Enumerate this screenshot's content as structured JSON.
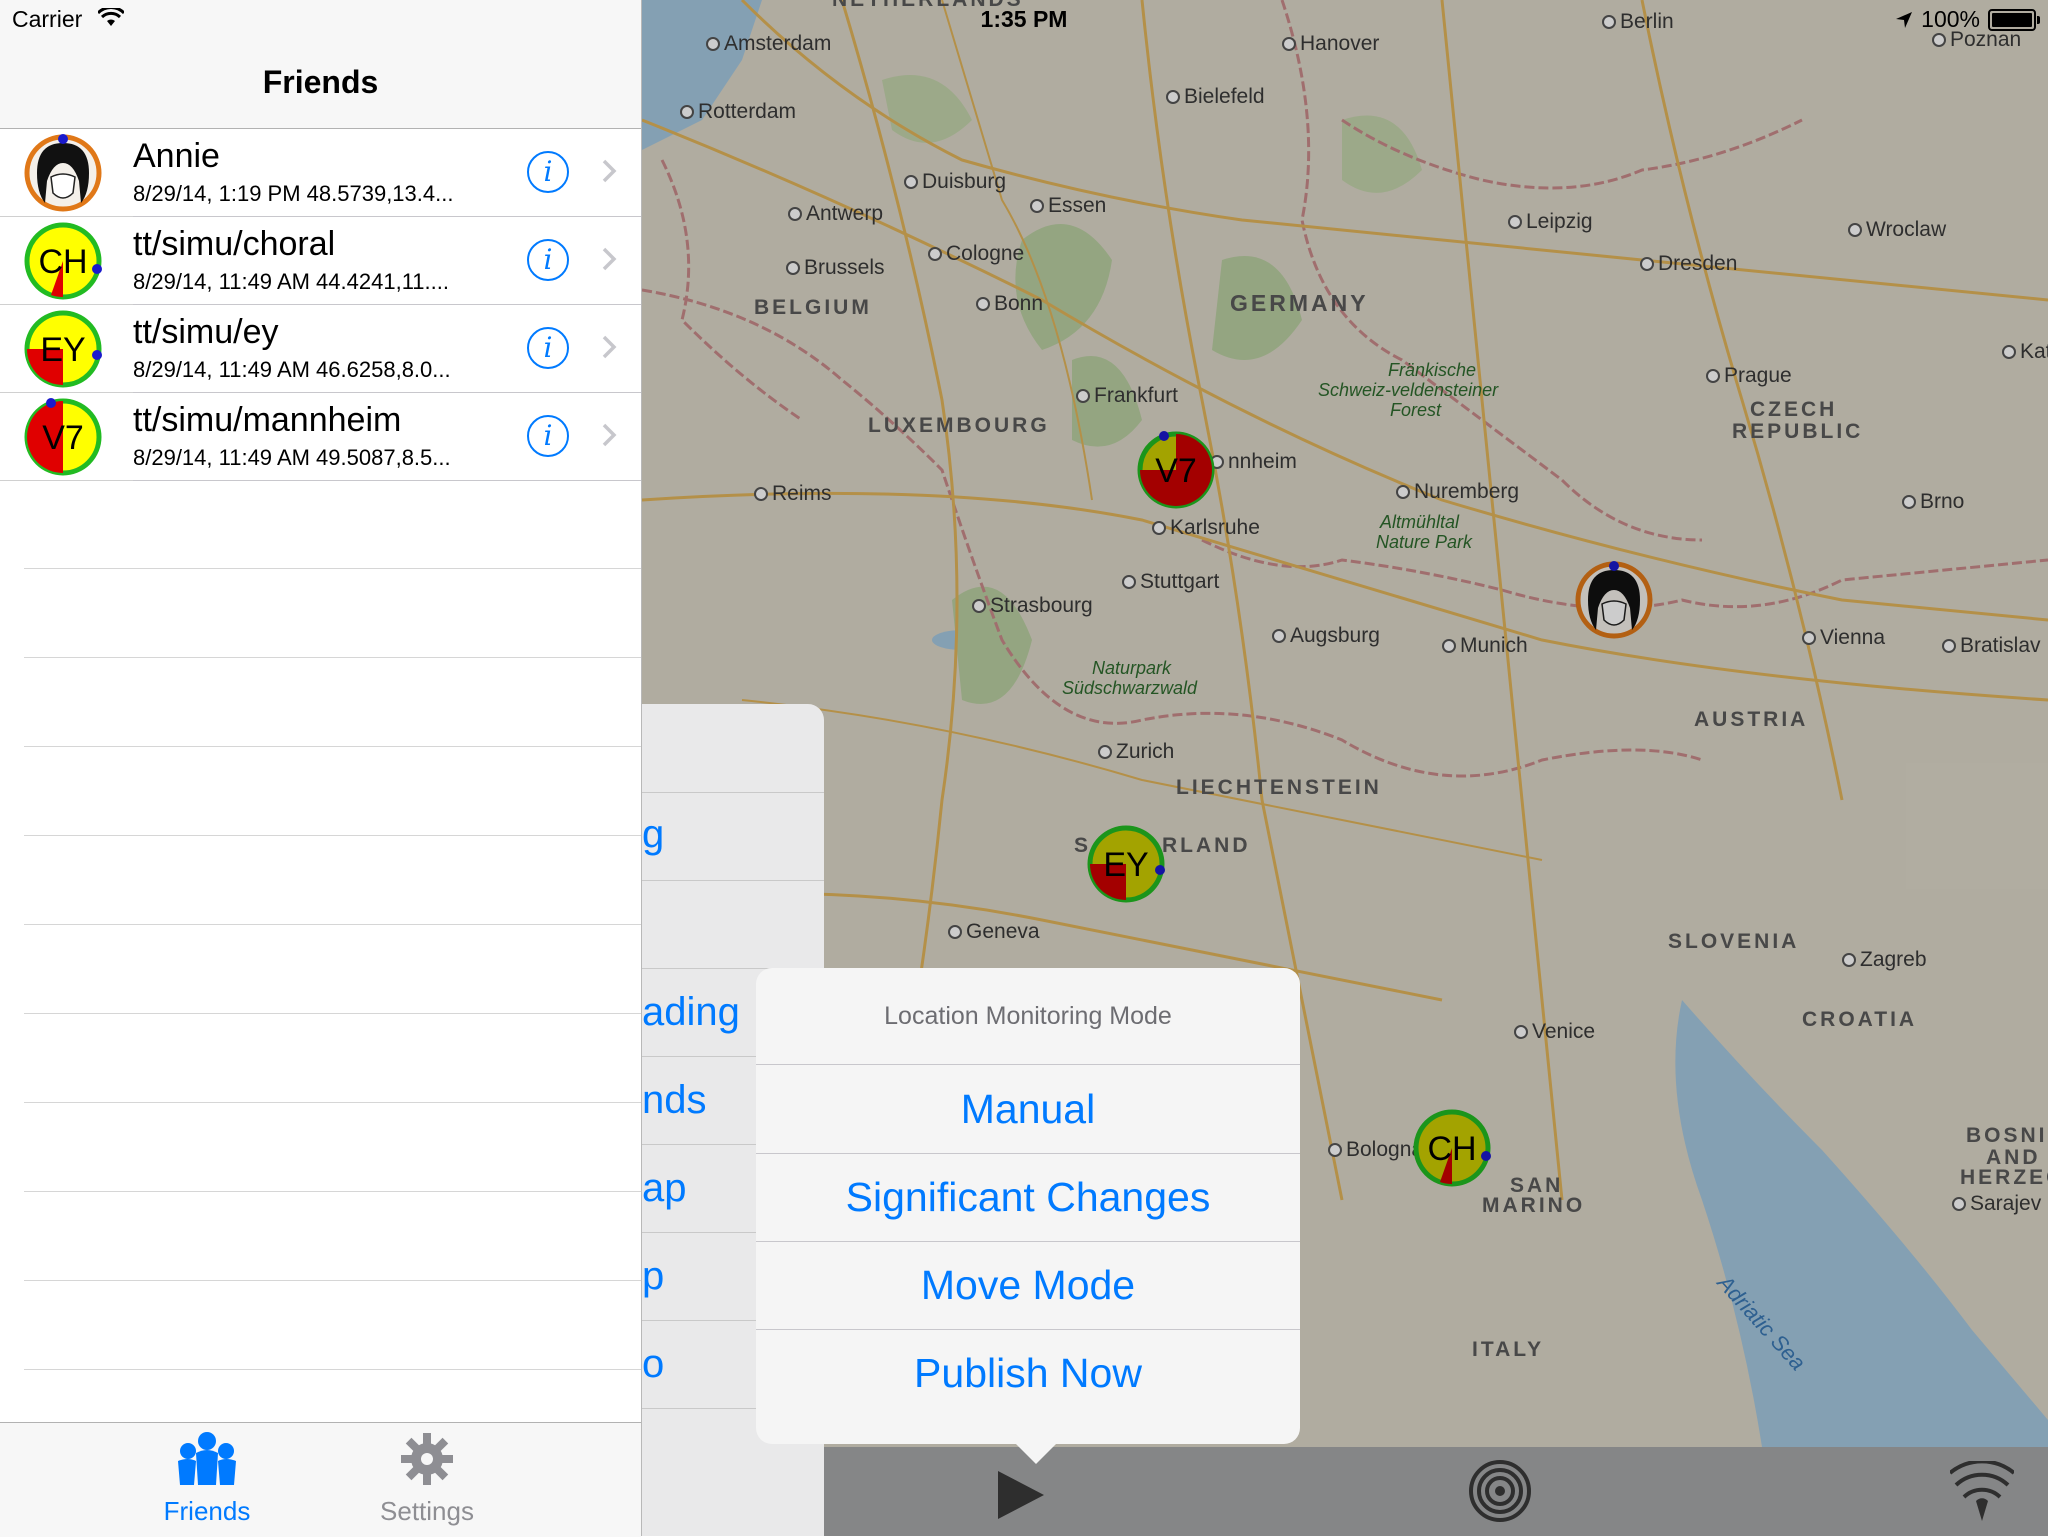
{
  "status_bar": {
    "carrier": "Carrier",
    "time": "1:35 PM",
    "battery": "100%"
  },
  "left_pane": {
    "title": "Friends",
    "friends": [
      {
        "name": "Annie",
        "detail": "8/29/14, 1:19 PM 48.5739,13.4...",
        "avatar": "portrait"
      },
      {
        "name": "tt/simu/choral",
        "detail": "8/29/14, 11:49 AM 44.4241,11....",
        "avatar": "CH"
      },
      {
        "name": "tt/simu/ey",
        "detail": "8/29/14, 11:49 AM 46.6258,8.0...",
        "avatar": "EY"
      },
      {
        "name": "tt/simu/mannheim",
        "detail": "8/29/14, 11:49 AM 49.5087,8.5...",
        "avatar": "V7"
      }
    ],
    "tabs": [
      {
        "label": "Friends",
        "icon": "friends-icon",
        "selected": true
      },
      {
        "label": "Settings",
        "icon": "gear-icon",
        "selected": false
      }
    ]
  },
  "map": {
    "cities": [
      "Amsterdam",
      "Hanover",
      "Berlin",
      "Poznan",
      "Rotterdam",
      "Bielefeld",
      "Duisburg",
      "Essen",
      "Antwerp",
      "Leipzig",
      "Wroclaw",
      "Cologne",
      "Brussels",
      "Dresden",
      "Bonn",
      "Prague",
      "Frankfurt",
      "nnheim",
      "Reims",
      "Nuremberg",
      "Karlsruhe",
      "Brno",
      "Stuttgart",
      "Strasbourg",
      "Augsburg",
      "Munich",
      "Vienna",
      "Bratislav",
      "Zurich",
      "Geneva",
      "Zagreb",
      "Venice",
      "Bologna",
      "Sarajev",
      "Kat"
    ],
    "countries": [
      "NETHERLANDS",
      "BELGIUM",
      "GERMANY",
      "LUXEMBOURG",
      "CZECH",
      "REPUBLIC",
      "AUSTRIA",
      "LIECHTENSTEIN",
      "S",
      "RLAND",
      "SLOVENIA",
      "CROATIA",
      "SAN",
      "MARINO",
      "ITALY",
      "BOSNI",
      "AND",
      "HERZEGOV"
    ],
    "parks": [
      "Fränkische",
      "Schweiz-veldensteiner",
      "Forest",
      "Altmühltal",
      "Nature Park",
      "Naturpark",
      "Südschwarzwald"
    ],
    "sea": "Adriatic Sea",
    "pins": [
      {
        "label": "V7",
        "name": "pin-mannheim"
      },
      {
        "label": "EY",
        "name": "pin-ey"
      },
      {
        "label": "CH",
        "name": "pin-choral"
      },
      {
        "label": "",
        "name": "pin-annie"
      }
    ]
  },
  "side_menu": {
    "items": [
      "g",
      "ading",
      "nds",
      "ap",
      "p",
      "o"
    ]
  },
  "popover": {
    "title": "Location Monitoring Mode",
    "items": [
      "Manual",
      "Significant Changes",
      "Move Mode",
      "Publish Now"
    ]
  },
  "colors": {
    "accent": "#007aff",
    "pin_fill": "#ffff00",
    "pin_sector": "#e00000",
    "pin_ring": "#22bb22",
    "annie_ring": "#f07820"
  }
}
